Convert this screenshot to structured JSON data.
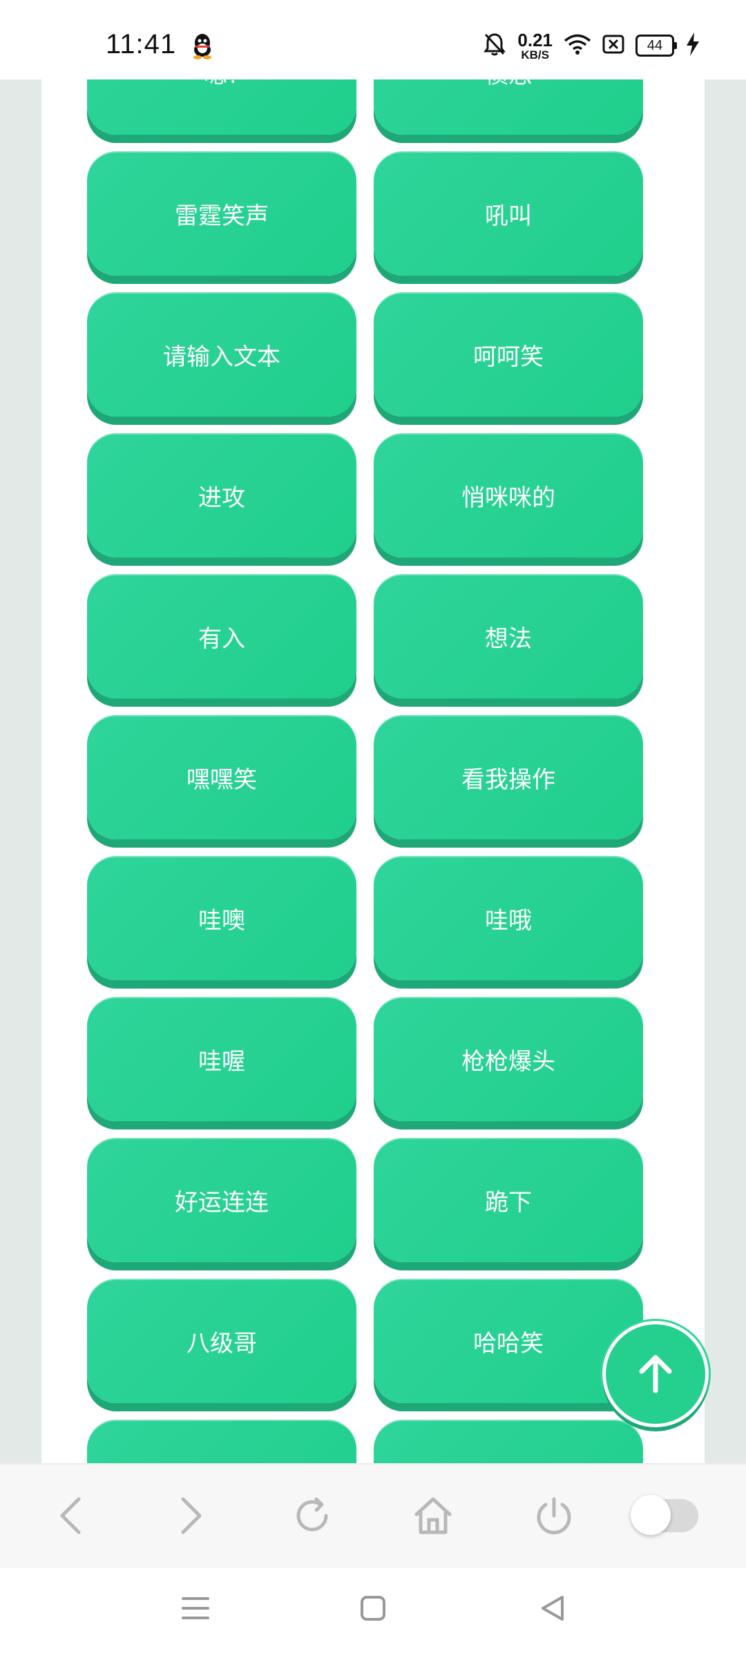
{
  "status_bar": {
    "time": "11:41",
    "net_speed_value": "0.21",
    "net_speed_unit": "KB/S",
    "battery_level": "44",
    "icons": [
      "qq-icon",
      "mute-bell-icon",
      "wifi-icon",
      "sim-off-icon",
      "battery-icon",
      "charging-bolt-icon"
    ]
  },
  "sound_buttons": [
    {
      "label": "嗯?"
    },
    {
      "label": "愤怒"
    },
    {
      "label": "雷霆笑声"
    },
    {
      "label": "吼叫"
    },
    {
      "label": "请输入文本"
    },
    {
      "label": "呵呵笑"
    },
    {
      "label": "进攻"
    },
    {
      "label": "悄咪咪的"
    },
    {
      "label": "有入"
    },
    {
      "label": "想法"
    },
    {
      "label": "嘿嘿笑"
    },
    {
      "label": "看我操作"
    },
    {
      "label": "哇噢"
    },
    {
      "label": "哇哦"
    },
    {
      "label": "哇喔"
    },
    {
      "label": "枪枪爆头"
    },
    {
      "label": "好运连连"
    },
    {
      "label": "跪下"
    },
    {
      "label": "八级哥"
    },
    {
      "label": "哈哈笑"
    },
    {
      "label": ""
    },
    {
      "label": ""
    }
  ],
  "fab": {
    "icon": "arrow-up-icon"
  },
  "browser_toolbar": {
    "icons": [
      "back-icon",
      "forward-icon",
      "refresh-icon",
      "home-icon",
      "power-icon"
    ],
    "toggle_on": false
  },
  "nav_bar": {
    "icons": [
      "menu-icon",
      "home-square-icon",
      "back-triangle-icon"
    ]
  },
  "colors": {
    "button_green": "#22cf8d",
    "button_shadow": "#1fa877",
    "page_side_bg": "#e3e9e6"
  }
}
